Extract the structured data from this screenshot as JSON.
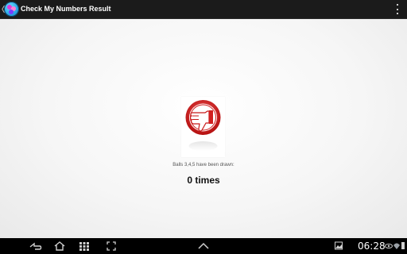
{
  "action_bar": {
    "title": "Check My Numbers Result",
    "up_icon": "back-caret-icon",
    "app_icon": "lottery-balls-app-icon",
    "menu_icon": "overflow-menu-icon"
  },
  "result": {
    "image_icon": "thumbs-down-icon",
    "message": "Balls 3,4,5 have been drawn:",
    "count_text": "0 times"
  },
  "system_bar": {
    "time": "06:28",
    "buttons": [
      "back-icon",
      "home-icon",
      "recent-apps-icon",
      "screenshot-icon",
      "up-chevron-icon"
    ],
    "status_icons": [
      "gallery-icon",
      "eye-icon",
      "wifi-icon",
      "signal-icon",
      "battery-icon"
    ]
  },
  "colors": {
    "action_bar": "#1b1b1b",
    "thumb_red": "#d11f1f",
    "nav_bar": "#000000"
  }
}
